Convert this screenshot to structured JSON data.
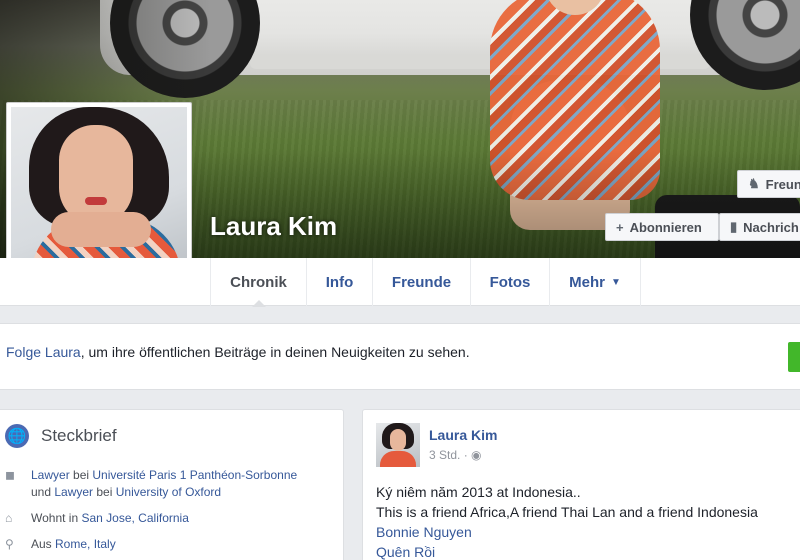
{
  "profile": {
    "name": "Laura Kim"
  },
  "cover_buttons": {
    "friend_label": "Freun",
    "subscribe_label": "Abonnieren",
    "message_label": "Nachrich"
  },
  "nav": {
    "items": [
      {
        "label": "Chronik"
      },
      {
        "label": "Info"
      },
      {
        "label": "Freunde"
      },
      {
        "label": "Fotos"
      },
      {
        "label": "Mehr"
      }
    ]
  },
  "follow_banner": {
    "link": "Folge Laura",
    "text": ", um ihre öffentlichen Beiträge in deinen Neuigkeiten zu sehen."
  },
  "intro": {
    "title": "Steckbrief",
    "work": {
      "job1": "Lawyer",
      "at1": " bei ",
      "place1": "Université Paris 1 Panthéon-Sorbonne",
      "and": " und ",
      "job2": "Lawyer",
      "at2": " bei ",
      "place2": "University of Oxford"
    },
    "lives": {
      "prefix": "Wohnt in ",
      "city": "San Jose, California"
    },
    "from": {
      "prefix": "Aus ",
      "city": "Rome, Italy"
    }
  },
  "post": {
    "author": "Laura Kim",
    "time": "3 Std. ·",
    "privacy_icon": "globe-icon",
    "line1": "Ký niêm năm 2013 at Indonesia..",
    "line2": "This is a friend Africa,A friend Thai Lan and a friend Indonesia",
    "line3": "Bonnie Nguyen",
    "line4": "Quên Rồi"
  },
  "colors": {
    "link": "#365899",
    "background": "#e9ebee",
    "green_button": "#42b72a"
  }
}
